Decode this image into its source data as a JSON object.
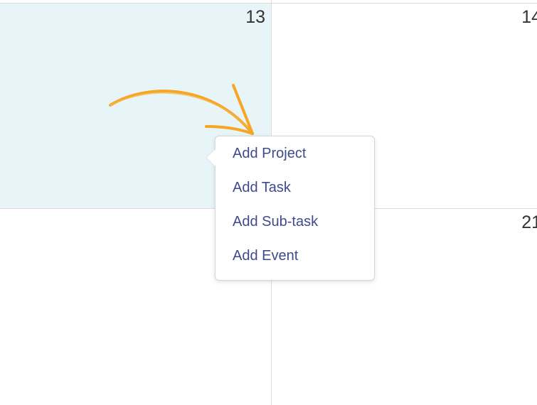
{
  "calendar": {
    "cells": [
      {
        "day": "13",
        "selected": true
      },
      {
        "day": "14",
        "selected": false
      },
      {
        "day": "",
        "selected": false
      },
      {
        "day": "21",
        "selected": false
      }
    ]
  },
  "annotation": {
    "icon": "curved-arrow-icon",
    "color": "#f5a623"
  },
  "context_menu": {
    "items": [
      {
        "label": "Add Project"
      },
      {
        "label": "Add Task"
      },
      {
        "label": "Add Sub-task"
      },
      {
        "label": "Add Event"
      }
    ]
  },
  "colors": {
    "selected_cell": "#e8f5f8",
    "menu_text": "#3e4a8c",
    "grid_line": "#dcdcdc"
  }
}
